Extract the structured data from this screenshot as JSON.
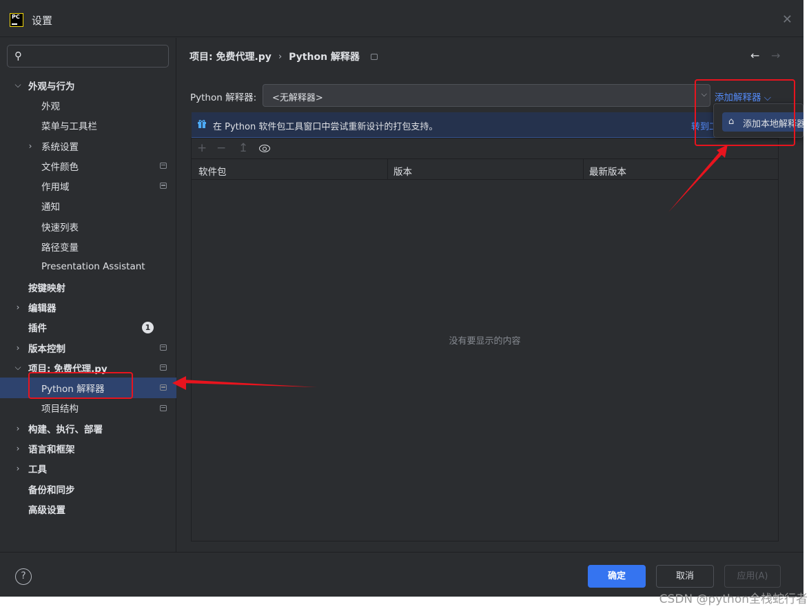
{
  "window": {
    "title": "设置"
  },
  "search": {
    "placeholder": ""
  },
  "sidebar": {
    "items": [
      {
        "label": "外观与行为",
        "bold": true,
        "chevron": "down",
        "indent": 0,
        "pinned": false
      },
      {
        "label": "外观",
        "bold": false,
        "chevron": "",
        "indent": 2,
        "pinned": false
      },
      {
        "label": "菜单与工具栏",
        "bold": false,
        "chevron": "",
        "indent": 2,
        "pinned": false
      },
      {
        "label": "系统设置",
        "bold": false,
        "chevron": "right",
        "indent": 1,
        "pinned": false
      },
      {
        "label": "文件颜色",
        "bold": false,
        "chevron": "",
        "indent": 2,
        "pinned": true
      },
      {
        "label": "作用域",
        "bold": false,
        "chevron": "",
        "indent": 2,
        "pinned": true
      },
      {
        "label": "通知",
        "bold": false,
        "chevron": "",
        "indent": 2,
        "pinned": false
      },
      {
        "label": "快速列表",
        "bold": false,
        "chevron": "",
        "indent": 2,
        "pinned": false
      },
      {
        "label": "路径变量",
        "bold": false,
        "chevron": "",
        "indent": 2,
        "pinned": false
      },
      {
        "label": "Presentation Assistant",
        "bold": false,
        "chevron": "",
        "indent": 2,
        "pinned": false
      },
      {
        "label": "按键映射",
        "bold": true,
        "chevron": "",
        "indent": 0,
        "pinned": false
      },
      {
        "label": "编辑器",
        "bold": true,
        "chevron": "right",
        "indent": 0,
        "pinned": false
      },
      {
        "label": "插件",
        "bold": true,
        "chevron": "",
        "indent": 0,
        "pinned": false,
        "badge": "1"
      },
      {
        "label": "版本控制",
        "bold": true,
        "chevron": "right",
        "indent": 0,
        "pinned": true
      },
      {
        "label": "项目: 免费代理.py",
        "bold": true,
        "chevron": "down",
        "indent": 0,
        "pinned": true
      },
      {
        "label": "Python 解释器",
        "bold": false,
        "chevron": "",
        "indent": 2,
        "pinned": true,
        "selected": true
      },
      {
        "label": "项目结构",
        "bold": false,
        "chevron": "",
        "indent": 2,
        "pinned": true
      },
      {
        "label": "构建、执行、部署",
        "bold": true,
        "chevron": "right",
        "indent": 0,
        "pinned": false
      },
      {
        "label": "语言和框架",
        "bold": true,
        "chevron": "right",
        "indent": 0,
        "pinned": false
      },
      {
        "label": "工具",
        "bold": true,
        "chevron": "right",
        "indent": 0,
        "pinned": false
      },
      {
        "label": "备份和同步",
        "bold": true,
        "chevron": "",
        "indent": 0,
        "pinned": false
      },
      {
        "label": "高级设置",
        "bold": true,
        "chevron": "",
        "indent": 0,
        "pinned": false
      }
    ]
  },
  "breadcrumb": {
    "project": "项目: 免费代理.py",
    "separator": "›",
    "page": "Python 解释器"
  },
  "nav": {
    "back": "←",
    "forward": "→"
  },
  "interpreter": {
    "label": "Python 解释器:",
    "value": "<无解释器>",
    "add_link": "添加解释器 ⌵"
  },
  "banner": {
    "text": "在 Python 软件包工具窗口中尝试重新设计的打包支持。",
    "link": "转到工"
  },
  "toolbar": {
    "add": "+",
    "remove": "−",
    "upgrade": "↥"
  },
  "table": {
    "columns": [
      "软件包",
      "版本",
      "最新版本"
    ],
    "empty": "没有要显示的内容"
  },
  "popup": {
    "item": "添加本地解释器"
  },
  "footer": {
    "ok": "确定",
    "cancel": "取消",
    "apply": "应用(A)",
    "help": "?"
  },
  "watermark": "CSDN @python全栈蛇行者",
  "colors": {
    "background": "#2b2d30",
    "selection": "#2e436e",
    "accent": "#3574f0",
    "link": "#548af7",
    "annotation": "#e8141e"
  }
}
